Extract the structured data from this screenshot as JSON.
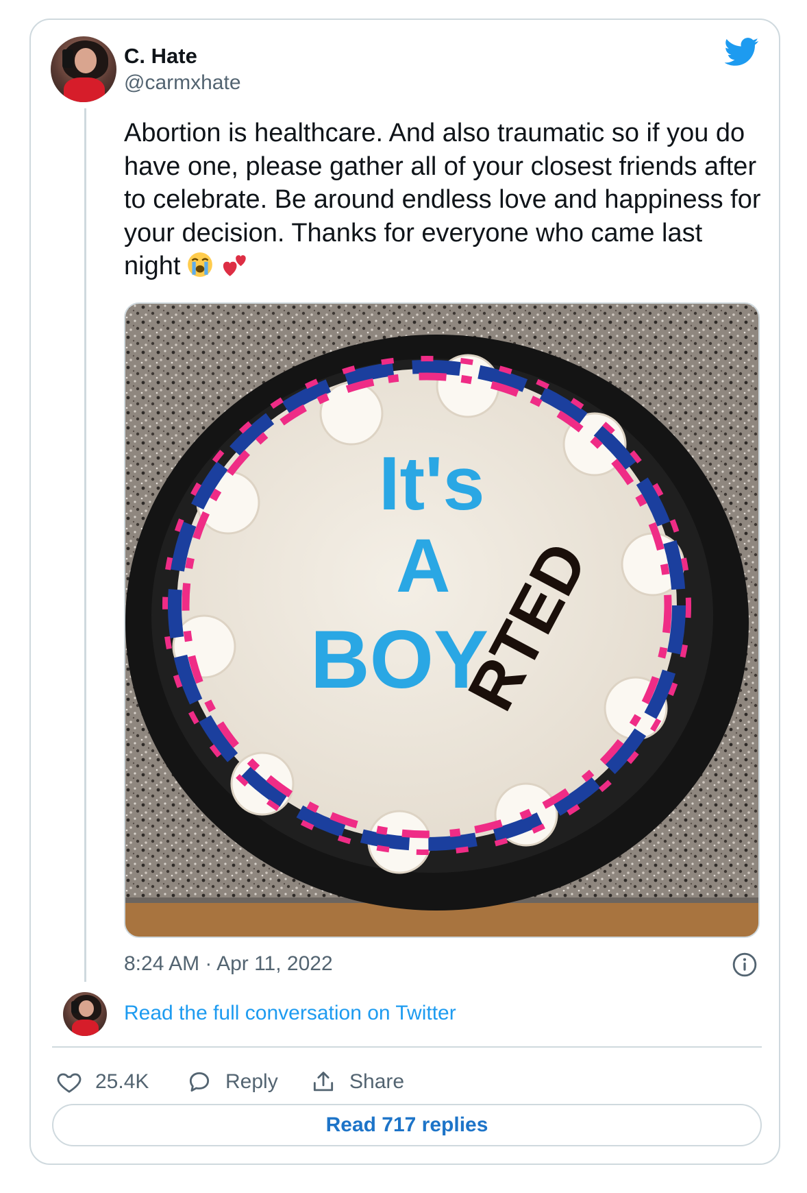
{
  "author": {
    "name": "C. Hate",
    "handle": "@carmxhate"
  },
  "tweet": {
    "text": "Abortion is healthcare. And also traumatic so if you do have one, please gather all of your closest friends after to celebrate. Be around endless love and happiness for your decision. Thanks for everyone who came last night",
    "emojis": [
      "loudly-crying-face-emoji",
      "two-hearts-emoji"
    ],
    "timestamp": "8:24 AM · Apr 11, 2022"
  },
  "media": {
    "cake_text": {
      "line1": "It's",
      "line2": "A",
      "line3": "BOY",
      "insert": "RTED"
    }
  },
  "conversation_link": "Read the full conversation on Twitter",
  "actions": {
    "likes": "25.4K",
    "reply_label": "Reply",
    "share_label": "Share"
  },
  "read_replies_label": "Read 717 replies",
  "colors": {
    "twitter_blue": "#1d9bf0",
    "link_blue": "#1d74c8",
    "muted": "#536471",
    "border": "#cfd9de"
  }
}
